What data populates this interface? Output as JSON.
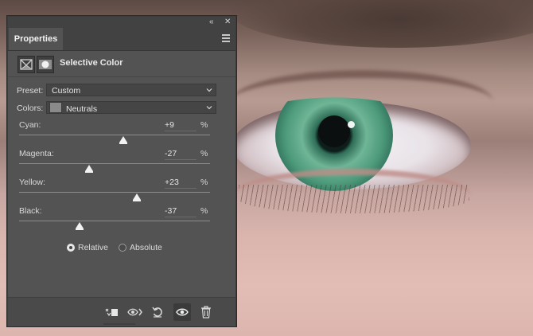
{
  "panel": {
    "tab_label": "Properties",
    "adjustment_title": "Selective Color"
  },
  "preset": {
    "label": "Preset:",
    "value": "Custom"
  },
  "colors": {
    "label": "Colors:",
    "value": "Neutrals",
    "swatch_color": "#8a8a8a"
  },
  "sliders": [
    {
      "name": "Cyan:",
      "value": "+9",
      "unit": "%",
      "level": 9
    },
    {
      "name": "Magenta:",
      "value": "-27",
      "unit": "%",
      "level": -27
    },
    {
      "name": "Yellow:",
      "value": "+23",
      "unit": "%",
      "level": 23
    },
    {
      "name": "Black:",
      "value": "-37",
      "unit": "%",
      "level": -37
    }
  ],
  "method": {
    "relative_label": "Relative",
    "absolute_label": "Absolute",
    "selected": "relative"
  },
  "footer_icons": [
    "clip-to-layer-icon",
    "view-previous-state-icon",
    "reset-icon",
    "visibility-eye-icon",
    "trash-icon"
  ],
  "colors_theme": {
    "panel_bg": "#535353",
    "header_bg": "#424242",
    "text": "#dcdcdc"
  }
}
